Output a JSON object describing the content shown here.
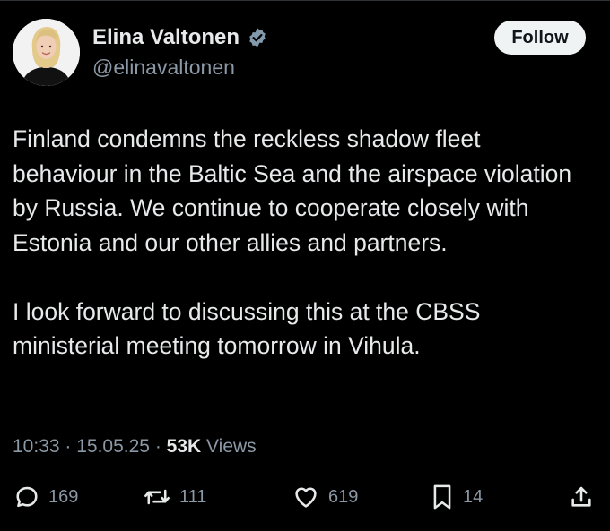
{
  "author": {
    "display_name": "Elina Valtonen",
    "handle": "@elinavaltonen",
    "verified": true,
    "avatar_icon": "profile-photo"
  },
  "follow_label": "Follow",
  "tweet": {
    "paragraph_1": "Finland condemns the reckless shadow fleet behaviour in the Baltic Sea and the airspace violation by Russia. We continue to cooperate closely with Estonia and our other allies and partners.",
    "paragraph_2": "I look forward to discussing this at the CBSS ministerial meeting tomorrow in Vihula."
  },
  "meta": {
    "time": "10:33",
    "separator": " · ",
    "date": "15.05.25",
    "views_count": "53K",
    "views_label": " Views"
  },
  "actions": {
    "replies": "169",
    "reposts": "111",
    "likes": "619",
    "bookmarks": "14"
  },
  "colors": {
    "background": "#000000",
    "text_primary": "#e7e9ea",
    "text_secondary": "#8b98a5",
    "verified_badge": "#829aab",
    "follow_button_bg": "#eff3f4"
  }
}
